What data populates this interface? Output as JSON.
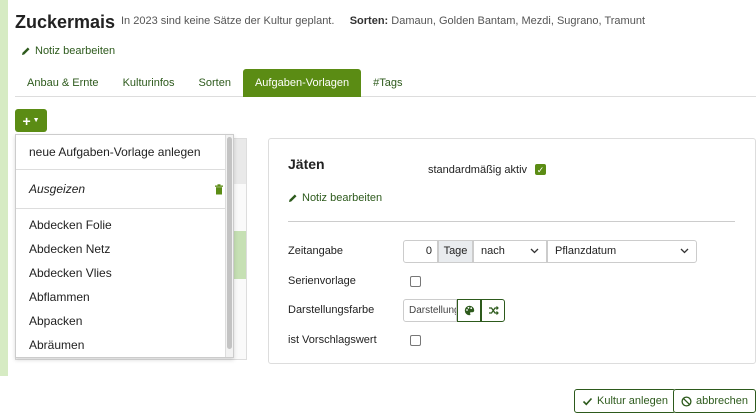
{
  "culture": {
    "title": "Zuckermais",
    "plan_info": "In 2023 sind keine Sätze der Kultur geplant.",
    "varieties_label": "Sorten:",
    "varieties": "Damaun, Golden Bantam, Mezdi, Sugrano, Tramunt",
    "note_link": "Notiz bearbeiten"
  },
  "tabs": [
    {
      "label": "Anbau & Ernte"
    },
    {
      "label": "Kulturinfos"
    },
    {
      "label": "Sorten"
    },
    {
      "label": "Aufgaben-Vorlagen",
      "active": true
    },
    {
      "label": "#Tags"
    }
  ],
  "add_button": {
    "label": "+",
    "icon": "caret-down-icon"
  },
  "dropdown": {
    "new_item": "neue Aufgaben-Vorlage anlegen",
    "italic_item": "Ausgeizen",
    "items": [
      "Abdecken Folie",
      "Abdecken Netz",
      "Abdecken Vlies",
      "Abflammen",
      "Abpacken",
      "Abräumen"
    ]
  },
  "task": {
    "title": "Jäten",
    "default_active_label": "standardmäßig aktiv",
    "default_active": true,
    "note_link": "Notiz bearbeiten",
    "time_label": "Zeitangabe",
    "time_value": "0",
    "time_unit": "Tage",
    "relation": "nach",
    "reference": "Pflanzdatum",
    "series_label": "Serienvorlage",
    "series": false,
    "color_label": "Darstellungsfarbe",
    "color_placeholder": "Darstellungsfarbe",
    "suggestion_label": "ist Vorschlagswert",
    "suggestion": false
  },
  "footer": {
    "save": "Kultur anlegen",
    "cancel": "abbrechen"
  },
  "colors": {
    "accent": "#5b8c14",
    "dark_green": "#2d5a1c",
    "light_green": "#d6ebc3"
  }
}
